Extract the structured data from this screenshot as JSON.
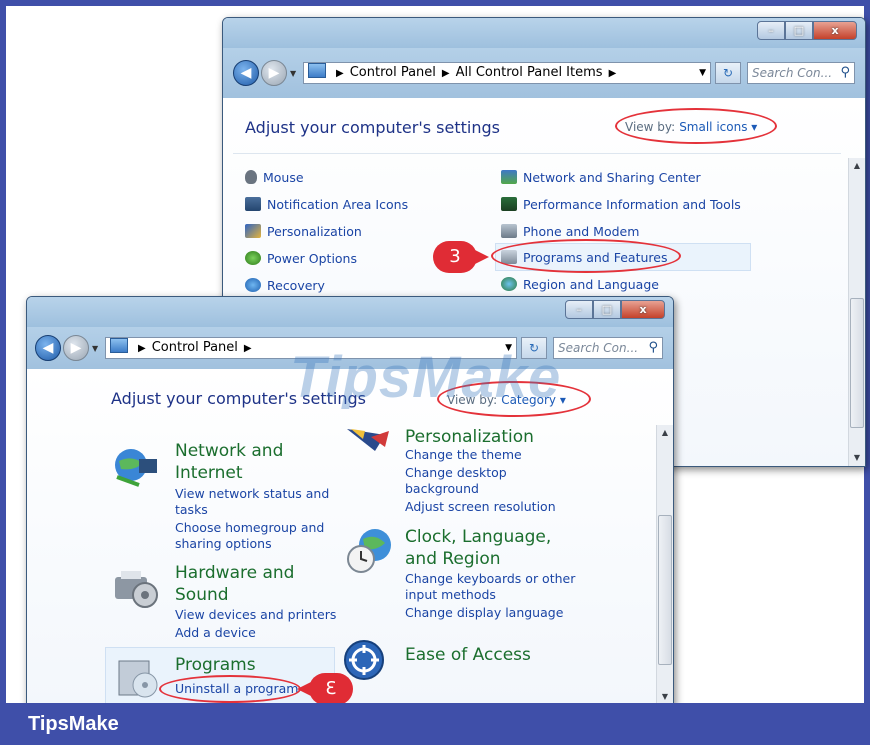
{
  "brand": {
    "footer": "TipsMake",
    "watermark": "TipsMake"
  },
  "colors": {
    "frame": "#3f4fa9",
    "annotation": "#e02c35",
    "link": "#1b45a5",
    "category": "#1b6e2e"
  },
  "back_window": {
    "caption": {
      "minimize": "–",
      "maximize": "□",
      "close": "x"
    },
    "breadcrumb": [
      "Control Panel",
      "All Control Panel Items"
    ],
    "search_placeholder": "Search Con...",
    "heading": "Adjust your computer's settings",
    "view_by_label": "View by:",
    "view_by_value": "Small icons ▾",
    "left_items": [
      {
        "label": "Mouse",
        "icon": "mouse-icon"
      },
      {
        "label": "Notification Area Icons",
        "icon": "notification-icon"
      },
      {
        "label": "Personalization",
        "icon": "personalization-icon"
      },
      {
        "label": "Power Options",
        "icon": "power-icon"
      },
      {
        "label": "Recovery",
        "icon": "recovery-icon"
      }
    ],
    "right_items": [
      {
        "label": "Network and Sharing Center",
        "icon": "network-icon"
      },
      {
        "label": "Performance Information and Tools",
        "icon": "performance-icon"
      },
      {
        "label": "Phone and Modem",
        "icon": "phone-icon"
      },
      {
        "label": "Programs and Features",
        "icon": "programs-icon"
      },
      {
        "label": "Region and Language",
        "icon": "region-icon"
      }
    ],
    "step_badge": "3"
  },
  "front_window": {
    "caption": {
      "minimize": "–",
      "maximize": "□",
      "close": "x"
    },
    "breadcrumb": [
      "Control Panel"
    ],
    "search_placeholder": "Search Con...",
    "heading": "Adjust your computer's settings",
    "view_by_label": "View by:",
    "view_by_value": "Category ▾",
    "categories_left": [
      {
        "title1": "Network and",
        "title2": "Internet",
        "links": [
          "View network status and",
          "tasks",
          "Choose homegroup and",
          "sharing options"
        ]
      },
      {
        "title1": "Hardware and",
        "title2": "Sound",
        "links": [
          "View devices and printers",
          "Add a device"
        ]
      },
      {
        "title1": "Programs",
        "links": [
          "Uninstall a program"
        ]
      }
    ],
    "categories_right": [
      {
        "title1": "Personalization",
        "links": [
          "Change the theme",
          "Change desktop",
          "background",
          "Adjust screen resolution"
        ]
      },
      {
        "title1": "Clock, Language,",
        "title2": "and Region",
        "links": [
          "Change keyboards or other",
          "input methods",
          "Change display language"
        ]
      },
      {
        "title1": "Ease of Access"
      }
    ],
    "step_badge": "3"
  }
}
